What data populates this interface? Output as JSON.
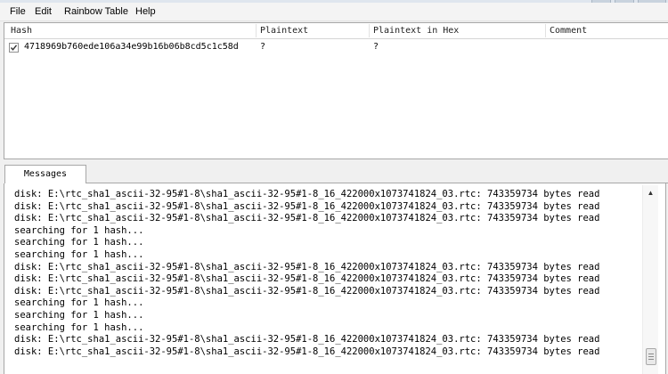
{
  "menu": {
    "items": [
      {
        "label": "File"
      },
      {
        "label": "Edit"
      },
      {
        "label": "Rainbow Table"
      },
      {
        "label": "Help"
      }
    ]
  },
  "hash_table": {
    "columns": [
      "Hash",
      "Plaintext",
      "Plaintext in Hex",
      "Comment"
    ],
    "rows": [
      {
        "checked": true,
        "hash": "4718969b760ede106a34e99b16b06b8cd5c1c58d",
        "plaintext": "?",
        "plaintext_hex": "?",
        "comment": ""
      }
    ]
  },
  "messages": {
    "tab_label": "Messages",
    "lines": [
      "disk: E:\\rtc_sha1_ascii-32-95#1-8\\sha1_ascii-32-95#1-8_16_422000x1073741824_03.rtc: 743359734 bytes read",
      "disk: E:\\rtc_sha1_ascii-32-95#1-8\\sha1_ascii-32-95#1-8_16_422000x1073741824_03.rtc: 743359734 bytes read",
      "disk: E:\\rtc_sha1_ascii-32-95#1-8\\sha1_ascii-32-95#1-8_16_422000x1073741824_03.rtc: 743359734 bytes read",
      "searching for 1 hash...",
      "searching for 1 hash...",
      "searching for 1 hash...",
      "disk: E:\\rtc_sha1_ascii-32-95#1-8\\sha1_ascii-32-95#1-8_16_422000x1073741824_03.rtc: 743359734 bytes read",
      "disk: E:\\rtc_sha1_ascii-32-95#1-8\\sha1_ascii-32-95#1-8_16_422000x1073741824_03.rtc: 743359734 bytes read",
      "disk: E:\\rtc_sha1_ascii-32-95#1-8\\sha1_ascii-32-95#1-8_16_422000x1073741824_03.rtc: 743359734 bytes read",
      "searching for 1 hash...",
      "searching for 1 hash...",
      "searching for 1 hash...",
      "disk: E:\\rtc_sha1_ascii-32-95#1-8\\sha1_ascii-32-95#1-8_16_422000x1073741824_03.rtc: 743359734 bytes read",
      "disk: E:\\rtc_sha1_ascii-32-95#1-8\\sha1_ascii-32-95#1-8_16_422000x1073741824_03.rtc: 743359734 bytes read"
    ]
  },
  "scrollbar": {
    "up_icon": "▲"
  }
}
